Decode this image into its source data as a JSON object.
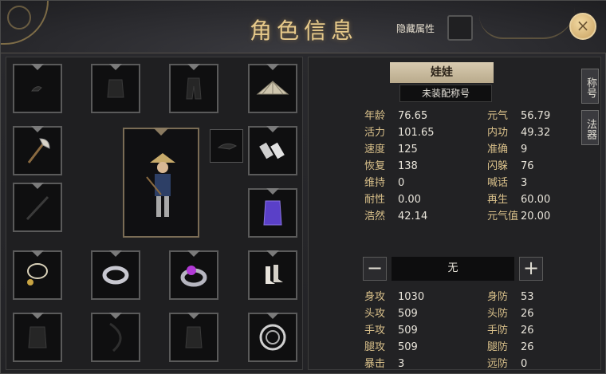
{
  "header": {
    "title": "角色信息",
    "hidden_attr_label": "隐藏属性",
    "close_symbol": "×"
  },
  "character": {
    "name": "娃娃",
    "title": "未装配称号"
  },
  "side_tabs": [
    "称号",
    "法器"
  ],
  "stats_left": [
    {
      "label": "年龄",
      "value": "76.65"
    },
    {
      "label": "活力",
      "value": "101.65"
    },
    {
      "label": "速度",
      "value": "125"
    },
    {
      "label": "恢复",
      "value": "138"
    },
    {
      "label": "维持",
      "value": "0"
    },
    {
      "label": "耐性",
      "value": "0.00"
    },
    {
      "label": "浩然",
      "value": "42.14"
    }
  ],
  "stats_right": [
    {
      "label": "元气",
      "value": "56.79"
    },
    {
      "label": "内功",
      "value": "49.32"
    },
    {
      "label": "准确",
      "value": "9"
    },
    {
      "label": "闪躲",
      "value": "76"
    },
    {
      "label": "喊话",
      "value": "3"
    },
    {
      "label": "再生",
      "value": "60.00"
    },
    {
      "label": "元气值",
      "value": "20.00"
    }
  ],
  "stepper": {
    "minus": "−",
    "plus": "+",
    "value": "无"
  },
  "combat_left": [
    {
      "label": "身攻",
      "value": "1030"
    },
    {
      "label": "头攻",
      "value": "509"
    },
    {
      "label": "手攻",
      "value": "509"
    },
    {
      "label": "腿攻",
      "value": "509"
    },
    {
      "label": "暴击",
      "value": "3"
    }
  ],
  "combat_right": [
    {
      "label": "身防",
      "value": "53"
    },
    {
      "label": "头防",
      "value": "26"
    },
    {
      "label": "手防",
      "value": "26"
    },
    {
      "label": "腿防",
      "value": "26"
    },
    {
      "label": "远防",
      "value": "0"
    }
  ],
  "equipment_slots": [
    "hair-ornament-slot",
    "chest-armor-slot",
    "pants-slot",
    "hat-slot",
    "axe-weapon-slot",
    "gauntlets-slot",
    "spear-slot",
    "robe-slot",
    "necklace-slot",
    "bracelet-slot",
    "ring-slot",
    "boots-slot",
    "inner-armor-slot",
    "bow-slot",
    "vest-slot",
    "token-slot"
  ]
}
